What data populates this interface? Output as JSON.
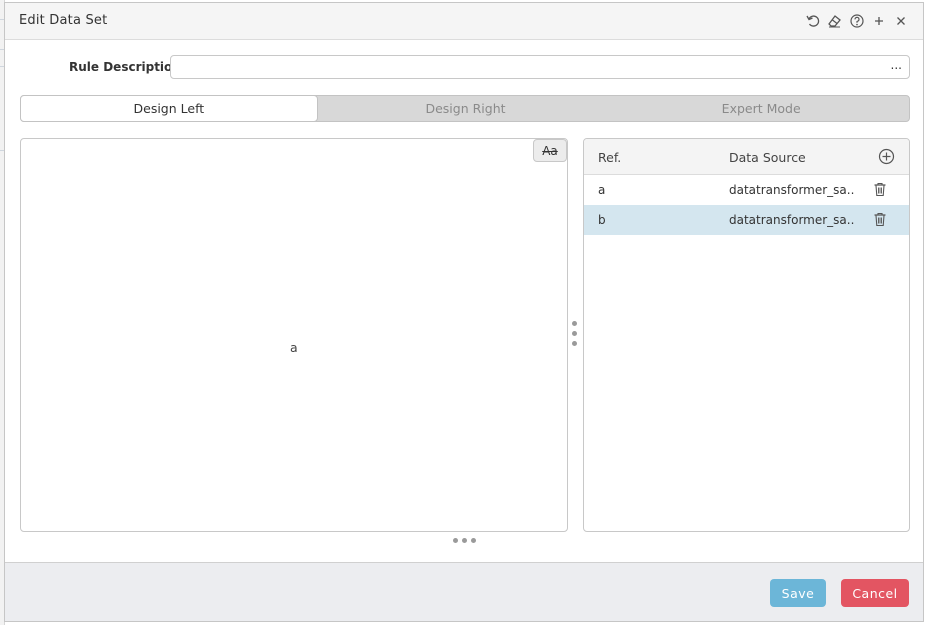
{
  "dialog": {
    "title": "Edit Data Set",
    "icons": [
      "undo-icon",
      "eraser-icon",
      "help-icon",
      "plus-icon",
      "close-icon"
    ]
  },
  "rule": {
    "label": "Rule Description:",
    "value": "",
    "placeholder": "",
    "more_label": "..."
  },
  "tabs": [
    {
      "label": "Design Left",
      "active": true
    },
    {
      "label": "Design Right",
      "active": false
    },
    {
      "label": "Expert Mode",
      "active": false
    }
  ],
  "designer": {
    "font_toggle_label": "Aa",
    "node_label": "a"
  },
  "datasets": {
    "columns": {
      "ref": "Ref.",
      "source": "Data Source"
    },
    "rows": [
      {
        "ref": "a",
        "source": "datatransformer_sa...",
        "selected": false
      },
      {
        "ref": "b",
        "source": "datatransformer_sa...",
        "selected": true
      }
    ]
  },
  "footer": {
    "save_label": "Save",
    "cancel_label": "Cancel"
  },
  "colors": {
    "selected_row": "#d4e6ef",
    "save": "#6cb6d8",
    "cancel": "#e35562"
  }
}
